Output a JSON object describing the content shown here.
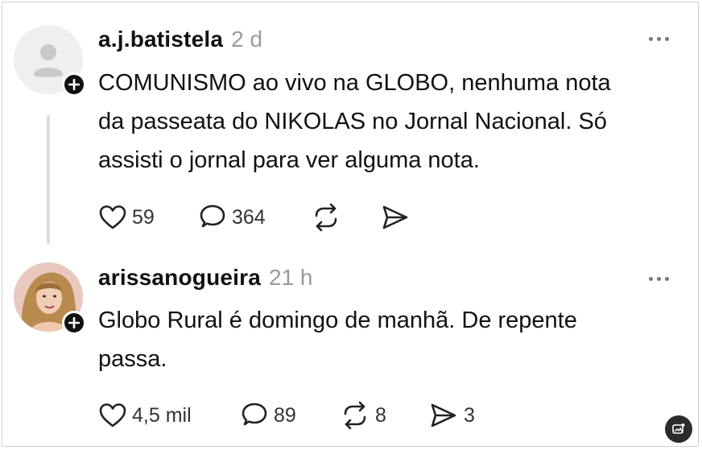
{
  "posts": [
    {
      "username": "a.j.batistela",
      "time": "2 d",
      "text_lines": [
        "COMUNISMO ao vivo na GLOBO, nenhuma nota",
        "da passeata do NIKOLAS no Jornal Nacional. Só",
        "assisti o jornal para ver alguma nota."
      ],
      "likes": "59",
      "replies": "364",
      "reposts": "",
      "shares": ""
    },
    {
      "username": "arissanogueira",
      "time": "21 h",
      "text_lines": [
        "Globo Rural é domingo de manhã. De repente",
        "passa."
      ],
      "likes": "4,5 mil",
      "replies": "89",
      "reposts": "8",
      "shares": "3"
    }
  ],
  "icons": {
    "like": "heart-icon",
    "reply": "comment-icon",
    "repost": "repost-icon",
    "share": "share-icon",
    "more": "more-icon",
    "follow": "plus-icon",
    "corner": "image-badge-icon"
  }
}
